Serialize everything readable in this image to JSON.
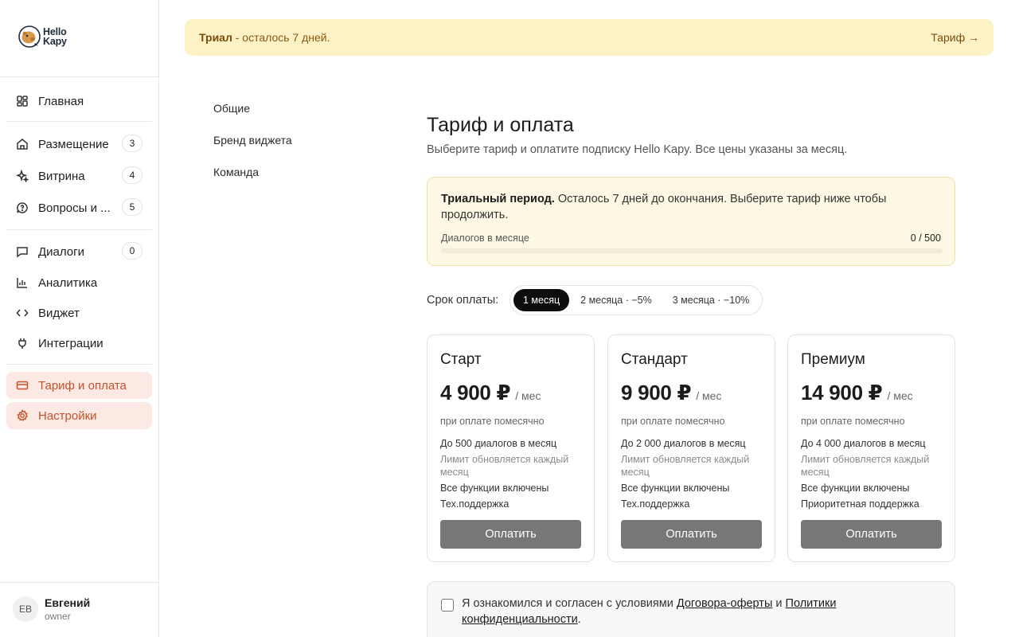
{
  "brand": {
    "logo_line1": "Hello",
    "logo_line2": "Kapy"
  },
  "sidebar": {
    "items": [
      {
        "label": "Главная",
        "icon": "dashboard-icon"
      },
      {
        "label": "Размещение",
        "icon": "home-icon",
        "badge": "3"
      },
      {
        "label": "Витрина",
        "icon": "sparkle-icon",
        "badge": "4"
      },
      {
        "label": "Вопросы и ...",
        "icon": "question-chat-icon",
        "badge": "5"
      },
      {
        "label": "Диалоги",
        "icon": "chat-icon",
        "badge": "0"
      },
      {
        "label": "Аналитика",
        "icon": "chart-icon"
      },
      {
        "label": "Виджет",
        "icon": "code-icon"
      },
      {
        "label": "Интеграции",
        "icon": "plug-icon"
      },
      {
        "label": "Тариф и оплата",
        "icon": "card-icon",
        "active": true
      },
      {
        "label": "Настройки",
        "icon": "gear-icon",
        "active": true
      }
    ],
    "user": {
      "initials": "ЕВ",
      "name": "Евгений",
      "role": "owner"
    }
  },
  "banner": {
    "strong": "Триал",
    "message": " - осталось 7 дней.",
    "link": "Тариф →"
  },
  "subnav": [
    "Общие",
    "Бренд виджета",
    "Команда"
  ],
  "main": {
    "title": "Тариф и оплата",
    "subtitle": "Выберите тариф и оплатите подписку Hello Kapy. Все цены указаны за месяц.",
    "trial": {
      "strong": "Триальный период.",
      "text": " Осталось 7 дней до окончания. Выберите тариф ниже чтобы продолжить.",
      "usage_label": "Диалогов в месяце",
      "usage_value": "0 / 500",
      "usage_fraction": 0
    },
    "period": {
      "label": "Срок оплаты:",
      "options": [
        "1 месяц",
        "2 месяца · −5%",
        "3 месяца · −10%"
      ],
      "selected": 0
    },
    "plans": [
      {
        "name": "Старт",
        "price": "4 900 ₽",
        "per": "/ мес",
        "billing": "при оплате помесячно",
        "f1": "До 500 диалогов в месяц",
        "f2": "Лимит обновляется каждый месяц",
        "f3": "Все функции включены",
        "f4": "Тех.поддержка",
        "button": "Оплатить"
      },
      {
        "name": "Стандарт",
        "price": "9 900 ₽",
        "per": "/ мес",
        "billing": "при оплате помесячно",
        "f1": "До 2 000 диалогов в месяц",
        "f2": "Лимит обновляется каждый месяц",
        "f3": "Все функции включены",
        "f4": "Тех.поддержка",
        "button": "Оплатить"
      },
      {
        "name": "Премиум",
        "price": "14 900 ₽",
        "per": "/ мес",
        "billing": "при оплате помесячно",
        "f1": "До 4 000 диалогов в месяц",
        "f2": "Лимит обновляется каждый месяц",
        "f3": "Все функции включены",
        "f4": "Приоритетная поддержка",
        "button": "Оплатить"
      }
    ],
    "consent": {
      "prefix": "Я ознакомился и согласен с условиями ",
      "link1": "Договора-оферты",
      "mid": " и ",
      "link2": "Политики конфиденциальности",
      "suffix": "."
    }
  },
  "colors": {
    "accent": "#c4522a",
    "accent_bg": "#fde9e3",
    "banner_bg": "#fdf2c6",
    "button": "#777777"
  }
}
